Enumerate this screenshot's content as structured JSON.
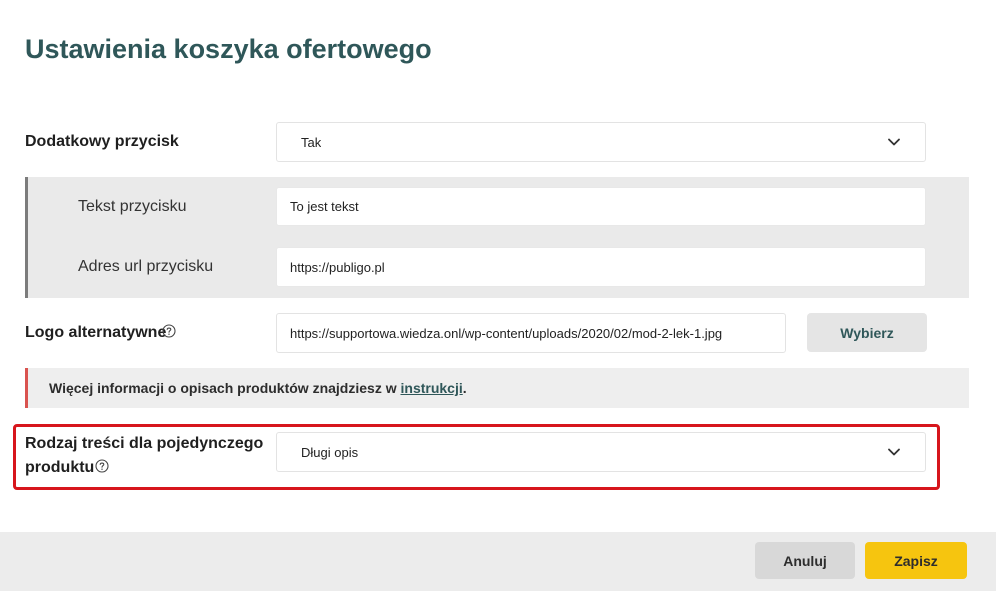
{
  "page": {
    "title": "Ustawienia koszyka ofertowego"
  },
  "extra_button": {
    "label": "Dodatkowy przycisk",
    "value": "Tak"
  },
  "button_text": {
    "label": "Tekst przycisku",
    "value": "To jest tekst"
  },
  "button_url": {
    "label": "Adres url przycisku",
    "value": "https://publigo.pl"
  },
  "alt_logo": {
    "label": "Logo alternatywne",
    "value": "https://supportowa.wiedza.onl/wp-content/uploads/2020/02/mod-2-lek-1.jpg",
    "button_label": "Wybierz"
  },
  "notice": {
    "text_before": "Więcej informacji o opisach produktów znajdziesz w ",
    "link_text": "instrukcji",
    "text_after": "."
  },
  "content_type": {
    "label_line1": "Rodzaj treści dla pojedynczego",
    "label_line2": "produktu",
    "value": "Długi opis"
  },
  "footer": {
    "cancel_label": "Anuluj",
    "save_label": "Zapisz"
  },
  "colors": {
    "title": "#2f5759",
    "save_button": "#f6c50f",
    "highlight_border": "#d7161c",
    "notice_accent": "#d9534f"
  },
  "icons": {
    "dropdown": "chevron-down-icon",
    "help": "question-circle-icon"
  }
}
